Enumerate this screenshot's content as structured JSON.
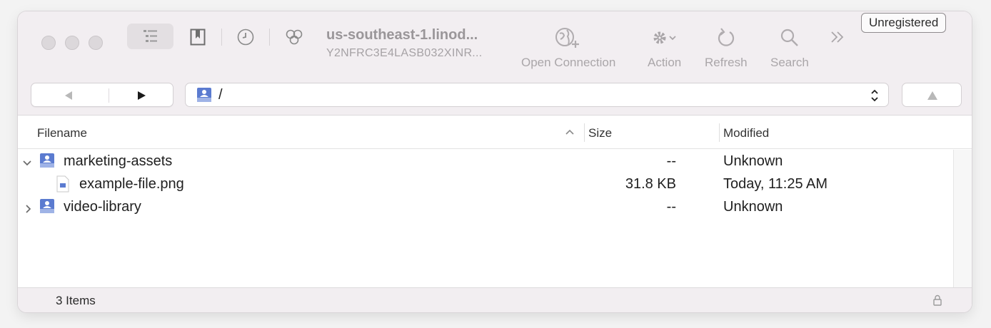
{
  "window": {
    "connection_title": "us-southeast-1.linod...",
    "connection_subtitle": "Y2NFRC3E4LASB032XINR...",
    "unregistered_label": "Unregistered"
  },
  "toolbar": {
    "icons": [
      "sidebar-icon",
      "bookmarks-icon",
      "history-icon",
      "bonjour-icon"
    ],
    "tools": [
      {
        "label": "Open Connection",
        "icon": "globe-plus-icon"
      },
      {
        "label": "Action",
        "icon": "gear-dropdown-icon"
      },
      {
        "label": "Refresh",
        "icon": "refresh-icon"
      },
      {
        "label": "Search",
        "icon": "search-icon"
      }
    ],
    "overflow_icon": "chevron-double-right-icon"
  },
  "path_bar": {
    "path": "/",
    "back_icon": "back-arrow-icon",
    "forward_icon": "forward-arrow-icon",
    "up_icon": "up-arrow-icon"
  },
  "columns": {
    "filename": "Filename",
    "size": "Size",
    "modified": "Modified"
  },
  "rows": [
    {
      "name": "marketing-assets",
      "size": "--",
      "modified": "Unknown",
      "type": "bucket",
      "expanded": true
    },
    {
      "name": "example-file.png",
      "size": "31.8 KB",
      "modified": "Today, 11:25 AM",
      "type": "file"
    },
    {
      "name": "video-library",
      "size": "--",
      "modified": "Unknown",
      "type": "bucket",
      "expanded": false
    }
  ],
  "status": {
    "items_count": "3 Items"
  },
  "colors": {
    "titlebar_bg": "#f2eef1",
    "toolbar_text": "#aaa6a9",
    "bucket_icon": "#5b7bd0"
  }
}
